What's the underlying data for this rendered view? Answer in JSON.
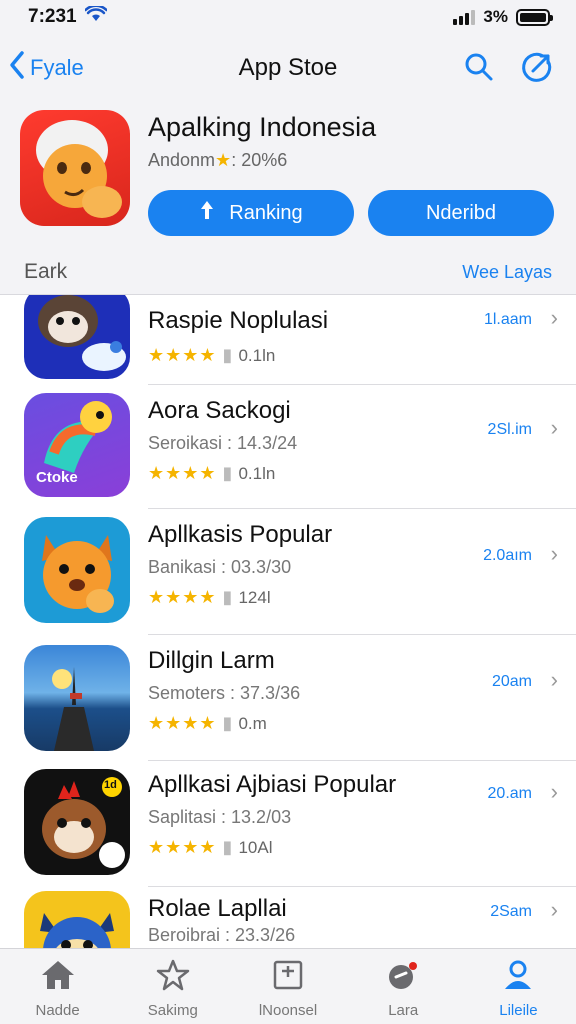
{
  "status": {
    "time": "7:231",
    "battery": "3%"
  },
  "nav": {
    "back_label": "Fyale",
    "title": "App Stoe"
  },
  "featured": {
    "title": "Apalking Indonesia",
    "subtitle_prefix": "Andonm",
    "subtitle_star": "★",
    "subtitle_suffix": ": 20%6",
    "btn_ranking": "Ranking",
    "btn_second": "Nderibd"
  },
  "section": {
    "title": "Eark",
    "link": "Wee Layas"
  },
  "apps": [
    {
      "title": "Raspie Noplulasi",
      "subtitle": "",
      "stars": "★★★★",
      "rating_text": "0.1ln",
      "size": "1l.aam"
    },
    {
      "title": "Aora Sackogi",
      "subtitle": "Seroikasi : 14.3/24",
      "stars": "★★★★",
      "rating_text": "0.1ln",
      "size": "2Sl.im",
      "icon_label": "Ctoke"
    },
    {
      "title": "Apllkasis Popular",
      "subtitle": "Banikasi : 03.3/30",
      "stars": "★★★★",
      "rating_text": "124l",
      "size": "2.0aım"
    },
    {
      "title": "Dillgin Larm",
      "subtitle": "Semoters : 37.3/36",
      "stars": "★★★★",
      "rating_text": "0.m",
      "size": "20am"
    },
    {
      "title": "Apllkasi Ajbiasi Popular",
      "subtitle": "Saplitasi : 13.2/03",
      "stars": "★★★★",
      "rating_text": "10Al",
      "size": "20.am",
      "badge": "1d"
    },
    {
      "title": "Rolae Lapllai",
      "subtitle": "Beroibrai : 23.3/26",
      "stars": "",
      "rating_text": "",
      "size": "2Sam"
    }
  ],
  "tabs": [
    {
      "label": "Nadde",
      "icon": "home-icon"
    },
    {
      "label": "Sakimg",
      "icon": "star-icon"
    },
    {
      "label": "lNoonsel",
      "icon": "apps-icon"
    },
    {
      "label": "Lara",
      "icon": "game-icon"
    },
    {
      "label": "Lileile",
      "icon": "person-icon",
      "active": true
    }
  ],
  "colors": {
    "accent": "#1a82f0",
    "star": "#f5b400",
    "background": "#f3f3f6"
  }
}
